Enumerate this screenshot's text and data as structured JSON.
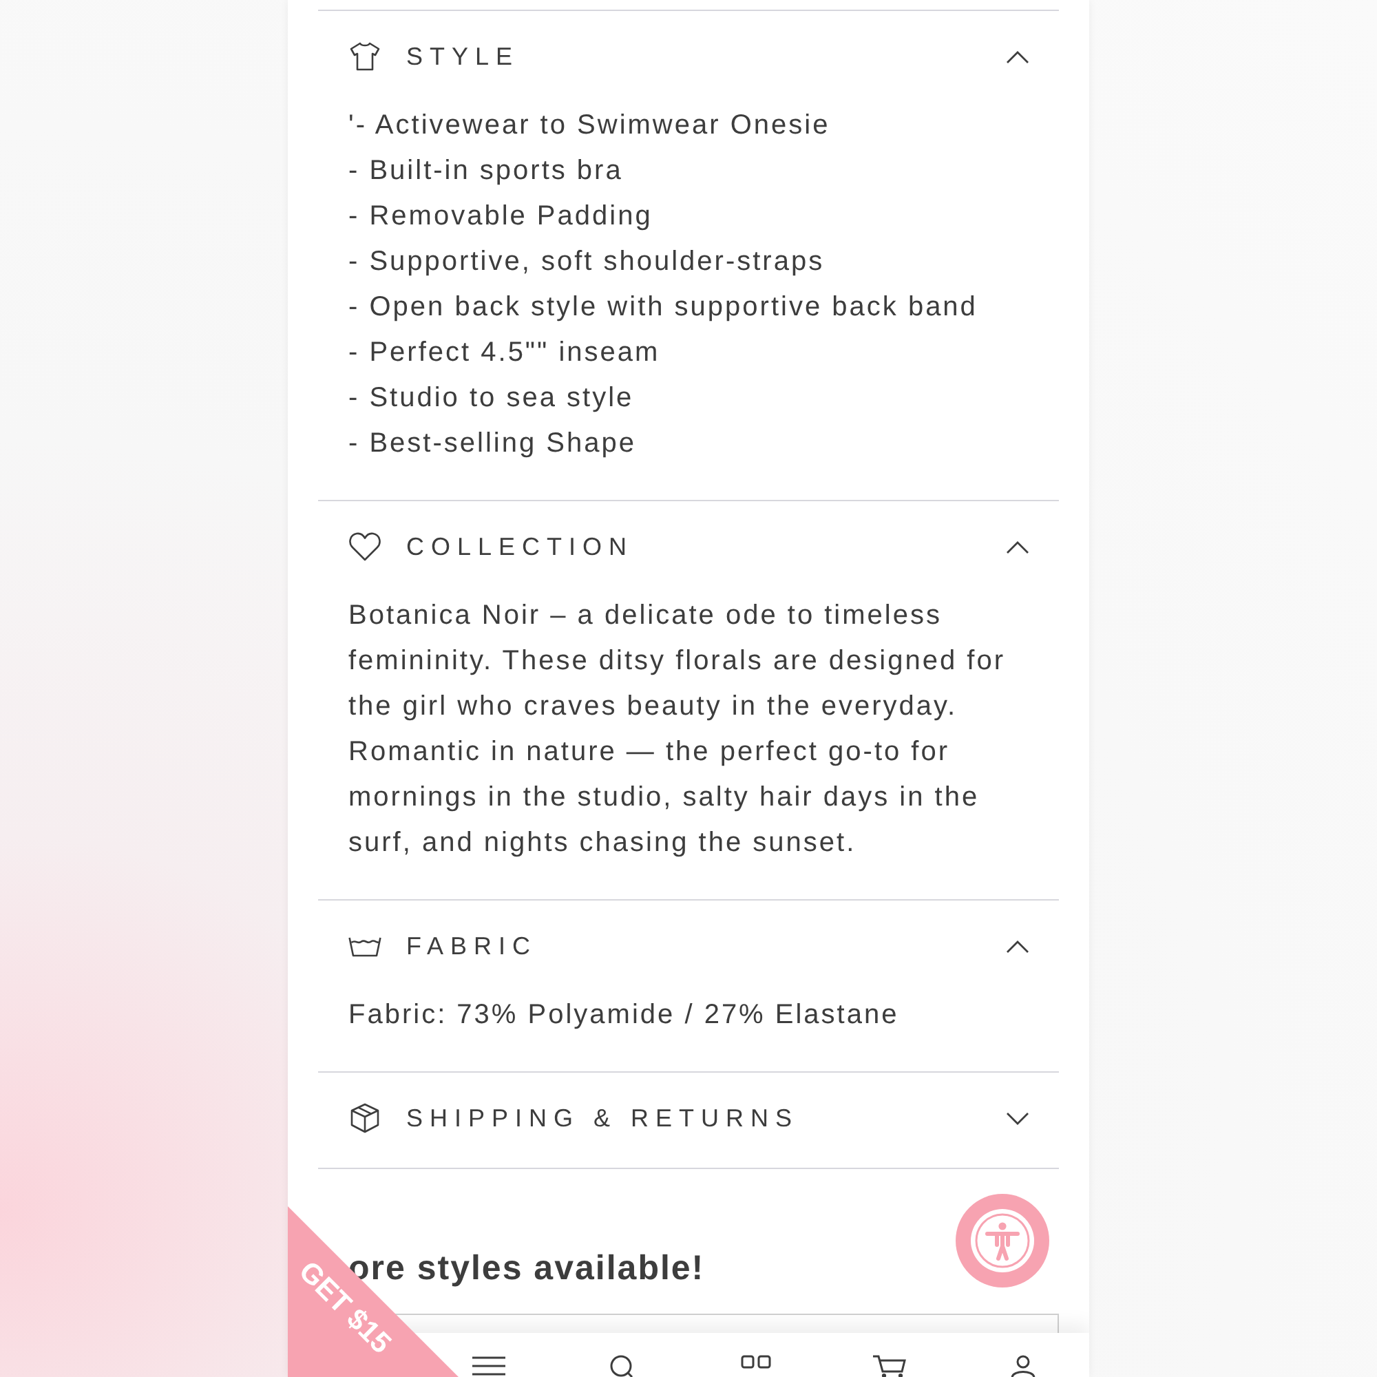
{
  "sections": [
    {
      "title": "STYLE",
      "expanded": true,
      "lines": [
        "'- Activewear to Swimwear Onesie",
        "- Built-in sports bra",
        "- Removable Padding",
        "- Supportive, soft shoulder-straps",
        "- Open back style with supportive back band",
        "- Perfect 4.5\"\" inseam",
        "- Studio to sea style",
        "- Best-selling Shape"
      ]
    },
    {
      "title": "COLLECTION",
      "expanded": true,
      "text": "Botanica Noir – a delicate ode to timeless femininity. These ditsy florals are designed for the girl who craves beauty in the everyday. Romantic in nature — the perfect go-to for mornings in the studio, salty hair days in the surf, and nights chasing the sunset."
    },
    {
      "title": "FABRIC",
      "expanded": true,
      "text": "Fabric: 73% Polyamide / 27% Elastane"
    },
    {
      "title": "SHIPPING & RETURNS",
      "expanded": false
    }
  ],
  "more_styles": {
    "heading": "ore styles available!"
  },
  "promo_ribbon": {
    "label": "GET $15"
  }
}
